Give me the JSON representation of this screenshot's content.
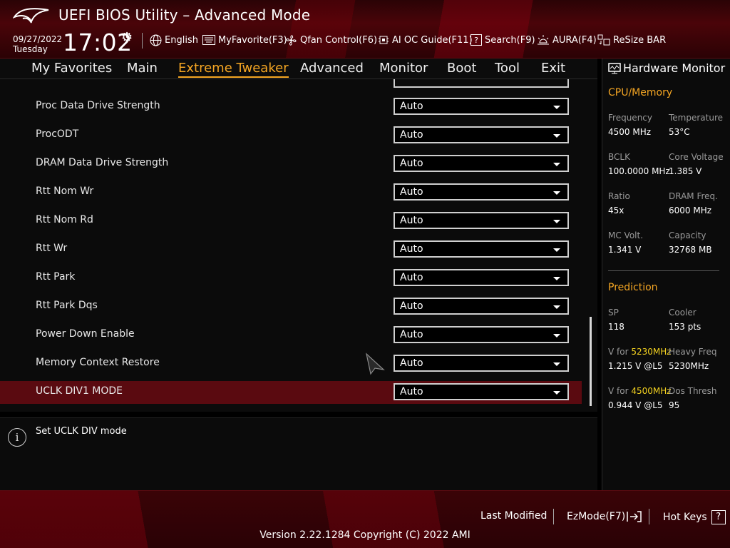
{
  "header": {
    "title": "UEFI BIOS Utility – Advanced Mode",
    "date": "09/27/2022",
    "day": "Tuesday",
    "time": "17:02",
    "tools": {
      "language": "English",
      "myfavorite": "MyFavorite(F3)",
      "qfan": "Qfan Control(F6)",
      "aioc": "AI OC Guide(F11)",
      "search": "Search(F9)",
      "aura": "AURA(F4)",
      "resizebar": "ReSize BAR"
    }
  },
  "nav": {
    "tabs": [
      "My Favorites",
      "Main",
      "Extreme Tweaker",
      "Advanced",
      "Monitor",
      "Boot",
      "Tool",
      "Exit"
    ],
    "active": "Extreme Tweaker"
  },
  "settings": {
    "rows": [
      {
        "label": "Proc Data Drive Strength",
        "value": "Auto"
      },
      {
        "label": "ProcODT",
        "value": "Auto"
      },
      {
        "label": "DRAM Data Drive Strength",
        "value": "Auto"
      },
      {
        "label": "Rtt Nom Wr",
        "value": "Auto"
      },
      {
        "label": "Rtt Nom Rd",
        "value": "Auto"
      },
      {
        "label": "Rtt Wr",
        "value": "Auto"
      },
      {
        "label": "Rtt Park",
        "value": "Auto"
      },
      {
        "label": "Rtt Park Dqs",
        "value": "Auto"
      },
      {
        "label": "Power Down Enable",
        "value": "Auto"
      },
      {
        "label": "Memory Context Restore",
        "value": "Auto"
      },
      {
        "label": "UCLK DIV1 MODE",
        "value": "Auto"
      }
    ],
    "selected_label": "UCLK DIV1 MODE"
  },
  "help": {
    "text": "Set UCLK DIV mode"
  },
  "hardware_monitor": {
    "title": "Hardware Monitor",
    "cpu_memory": {
      "heading": "CPU/Memory",
      "frequency_label": "Frequency",
      "frequency": "4500 MHz",
      "temperature_label": "Temperature",
      "temperature": "53°C",
      "bclk_label": "BCLK",
      "bclk": "100.0000 MHz",
      "core_voltage_label": "Core Voltage",
      "core_voltage": "1.385 V",
      "ratio_label": "Ratio",
      "ratio": "45x",
      "dram_freq_label": "DRAM Freq.",
      "dram_freq": "6000 MHz",
      "mc_volt_label": "MC Volt.",
      "mc_volt": "1.341 V",
      "capacity_label": "Capacity",
      "capacity": "32768 MB"
    },
    "prediction": {
      "heading": "Prediction",
      "sp_label": "SP",
      "sp": "118",
      "cooler_label": "Cooler",
      "cooler": "153 pts",
      "v_for_label": "V for",
      "v_for_freq_1": "5230MHz",
      "v_for_value_1": "1.215 V @L5",
      "heavy_freq_label": "Heavy Freq",
      "heavy_freq": "5230MHz",
      "v_for_freq_2": "4500MHz",
      "v_for_value_2": "0.944 V @L5",
      "dos_thresh_label": "Dos Thresh",
      "dos_thresh": "95"
    }
  },
  "footer": {
    "last_modified": "Last Modified",
    "ezmode": "EzMode(F7)",
    "hot_keys": "Hot Keys",
    "version": "Version 2.22.1284 Copyright (C) 2022 AMI"
  },
  "colors": {
    "accent": "#f5a623",
    "highlight": "#f5d320",
    "selected_row": "#5a0a10"
  }
}
